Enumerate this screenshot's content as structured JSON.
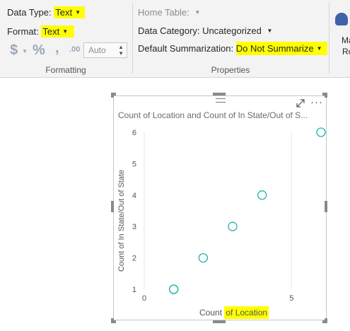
{
  "ribbon": {
    "formatting": {
      "data_type_label": "Data Type:",
      "data_type_value": "Text",
      "format_label": "Format:",
      "format_value": "Text",
      "currency_icon": "dollar-icon",
      "percent_icon": "percent-icon",
      "comma_icon": "comma-icon",
      "decimal_icon": "decimal-icon",
      "auto_value": "Auto",
      "group_label": "Formatting"
    },
    "properties": {
      "home_table_label": "Home Table:",
      "data_category_label": "Data Category:",
      "data_category_value": "Uncategorized",
      "default_summarization_label": "Default Summarization:",
      "default_summarization_value": "Do Not Summarize",
      "group_label": "Properties"
    },
    "overflow": {
      "line1": "Man",
      "line2": "Ro"
    }
  },
  "visual": {
    "title": "Count of Location and Count of In State/Out of S...",
    "expand_icon": "focus-mode-icon",
    "more_icon": "more-options-icon",
    "xlabel_prefix": "Count ",
    "xlabel_highlight": "of Location",
    "ylabel": "Count of In State/Out of State"
  },
  "chart_data": {
    "type": "scatter",
    "title": "Count of Location and Count of In State/Out of S...",
    "xlabel": "Count of Location",
    "ylabel": "Count of In State/Out of State",
    "xlim": [
      0,
      6
    ],
    "ylim": [
      1,
      6
    ],
    "x_ticks": [
      0,
      5
    ],
    "y_ticks": [
      1,
      2,
      3,
      4,
      5,
      6
    ],
    "points": [
      {
        "x": 1,
        "y": 1
      },
      {
        "x": 1,
        "y": 1
      },
      {
        "x": 2,
        "y": 2
      },
      {
        "x": 3,
        "y": 3
      },
      {
        "x": 4,
        "y": 4
      },
      {
        "x": 6,
        "y": 6
      }
    ],
    "color": "#20b2aa",
    "grid": true
  }
}
